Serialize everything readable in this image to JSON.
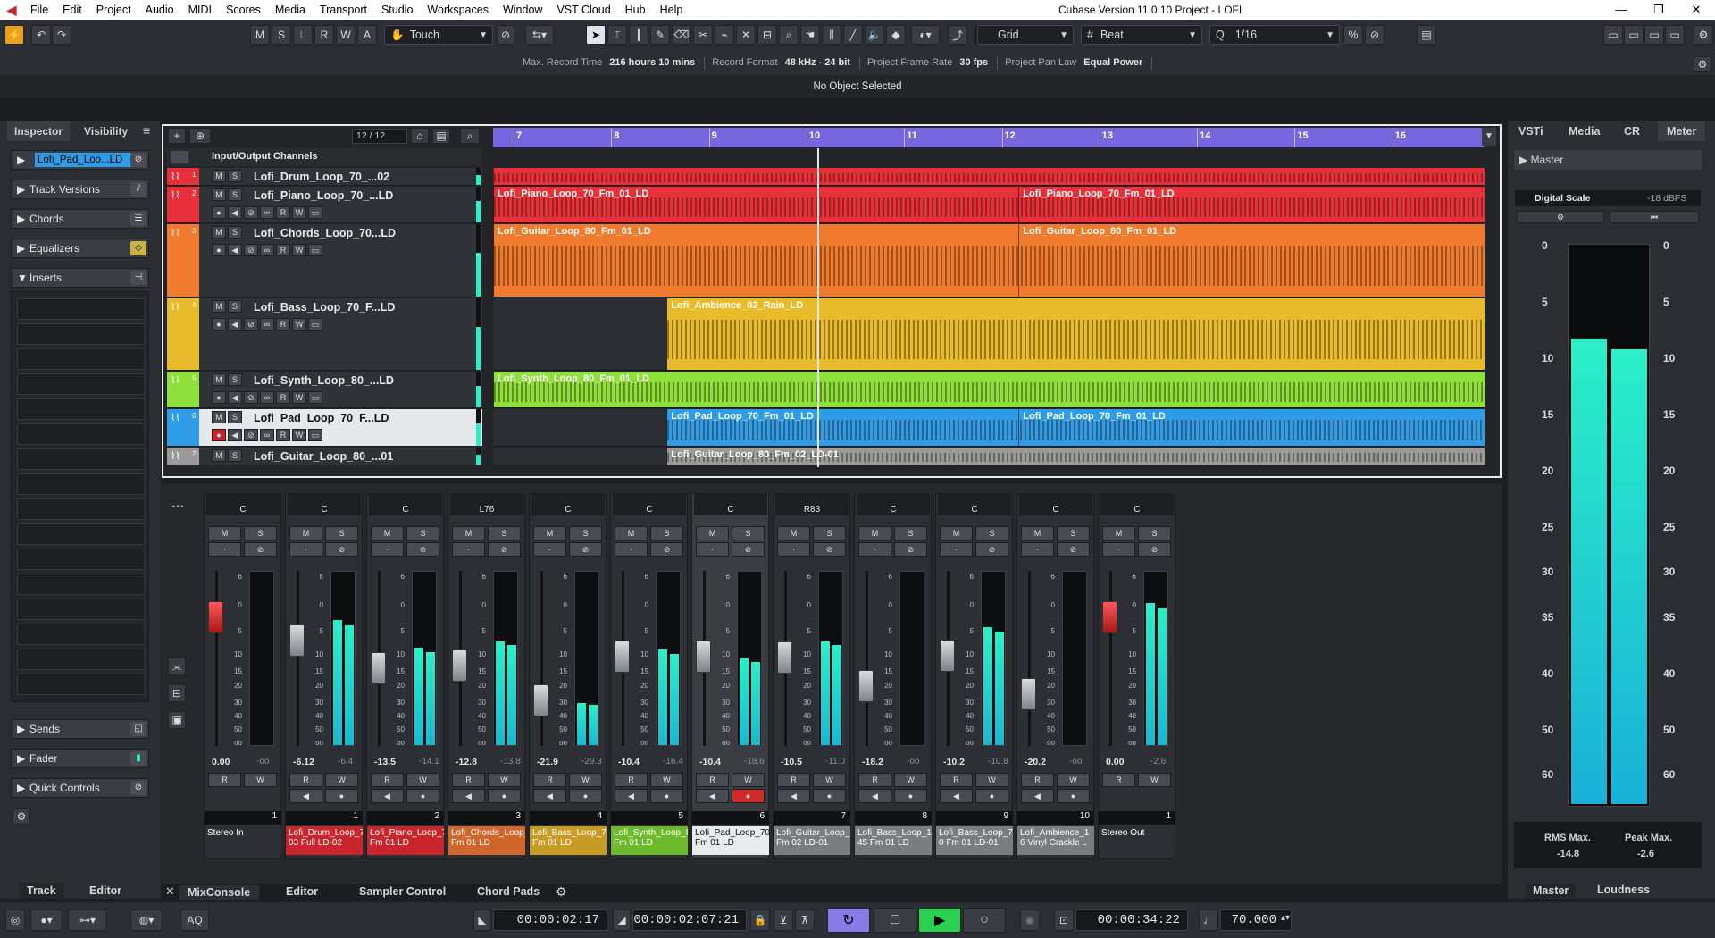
{
  "titlebar": {
    "menus": [
      "File",
      "Edit",
      "Project",
      "Audio",
      "MIDI",
      "Scores",
      "Media",
      "Transport",
      "Studio",
      "Workspaces",
      "Window",
      "VST Cloud",
      "Hub",
      "Help"
    ],
    "title": "Cubase Version 11.0.10 Project - LOFI",
    "minimize": "—",
    "maximize": "❐",
    "close": "✕"
  },
  "toolbar": {
    "state_buttons": [
      "M",
      "S",
      "L",
      "R",
      "W",
      "A"
    ],
    "automation_mode": "Touch",
    "snap_type": "Grid",
    "grid_type": "Beat",
    "quantize": "1/16",
    "info": {
      "max_record_time_label": "Max. Record Time",
      "max_record_time": "216 hours 10 mins",
      "record_format_label": "Record Format",
      "record_format": "48 kHz - 24 bit",
      "frame_rate_label": "Project Frame Rate",
      "frame_rate": "30 fps",
      "pan_law_label": "Project Pan Law",
      "pan_law": "Equal Power"
    },
    "status": "No Object Selected"
  },
  "inspector": {
    "tabs": [
      "Inspector",
      "Visibility"
    ],
    "selected_track": "Lofi_Pad_Loo...LD",
    "sections": [
      "Track Versions",
      "Chords",
      "Equalizers",
      "Inserts"
    ],
    "bottom_sections": [
      "Sends",
      "Fader",
      "Quick Controls"
    ],
    "bottom_tabs": [
      "Track",
      "Editor"
    ]
  },
  "project": {
    "position": "12 / 12",
    "io_label": "Input/Output Channels",
    "ruler": [
      "7",
      "8",
      "9",
      "10",
      "11",
      "12",
      "13",
      "14",
      "15",
      "16"
    ],
    "tracks": [
      {
        "num": "1",
        "name": "Lofi_Drum_Loop_70_...02",
        "color": "#e8303a",
        "clips": []
      },
      {
        "num": "2",
        "name": "Lofi_Piano_Loop_70_...LD",
        "color": "#e8303a",
        "clips": [
          "Lofi_Piano_Loop_70_Fm_01_LD",
          "Lofi_Piano_Loop_70_Fm_01_LD"
        ]
      },
      {
        "num": "3",
        "name": "Lofi_Chords_Loop_70...LD",
        "color": "#f07a2e",
        "clips": [
          "Lofi_Guitar_Loop_80_Fm_01_LD",
          "Lofi_Guitar_Loop_80_Fm_01_LD"
        ]
      },
      {
        "num": "4",
        "name": "Lofi_Bass_Loop_70_F...LD",
        "color": "#e8bb2a",
        "clips": [
          "Lofi_Ambience_02_Rain_LD"
        ]
      },
      {
        "num": "5",
        "name": "Lofi_Synth_Loop_80_...LD",
        "color": "#8ee03a",
        "clips": [
          "Lofi_Synth_Loop_80_Fm_01_LD"
        ]
      },
      {
        "num": "6",
        "name": "Lofi_Pad_Loop_70_F...LD",
        "color": "#2f9ce8",
        "clips": [
          "Lofi_Pad_Loop_70_Fm_01_LD",
          "Lofi_Pad_Loop_70_Fm_01_LD"
        ]
      },
      {
        "num": "7",
        "name": "Lofi_Guitar_Loop_80_...01",
        "color": "#9a9a9a",
        "clips": [
          "Lofi_Guitar_Loop_80_Fm_02_LD-01"
        ]
      }
    ]
  },
  "mixer": {
    "channels": [
      {
        "pan": "C",
        "fader": "0.00",
        "peak": "-oo",
        "num": "1",
        "name": "Stereo In",
        "color": "#2c2f33",
        "level": 0
      },
      {
        "pan": "C",
        "fader": "-6.12",
        "peak": "-6.4",
        "num": "1",
        "name": "Lofi_Drum_Loop_70 03 Full LD-02",
        "color": "#c8262c",
        "level": 0.72
      },
      {
        "pan": "C",
        "fader": "-13.5",
        "peak": "-14.1",
        "num": "2",
        "name": "Lofi_Piano_Loop_70 Fm 01 LD",
        "color": "#c8262c",
        "level": 0.56
      },
      {
        "pan": "L76",
        "fader": "-12.8",
        "peak": "-13.8",
        "num": "3",
        "name": "Lofi_Chords_Loop_70 Fm 01 LD",
        "color": "#d0662a",
        "level": 0.6
      },
      {
        "pan": "C",
        "fader": "-21.9",
        "peak": "-29.3",
        "num": "4",
        "name": "Lofi_Bass_Loop_70 Fm 01 LD",
        "color": "#c89c24",
        "level": 0.24
      },
      {
        "pan": "C",
        "fader": "-10.4",
        "peak": "-16.4",
        "num": "5",
        "name": "Lofi_Synth_Loop_80 Fm 01 LD",
        "color": "#6cba2c",
        "level": 0.55
      },
      {
        "pan": "C",
        "fader": "-10.4",
        "peak": "-18.6",
        "num": "6",
        "name": "Lofi_Pad_Loop_70 Fm 01 LD",
        "color": "#e9ebee",
        "level": 0.5
      },
      {
        "pan": "R83",
        "fader": "-10.5",
        "peak": "-11.0",
        "num": "7",
        "name": "Lofi_Guitar_Loop_80 Fm 02 LD-01",
        "color": "#7a7d80",
        "level": 0.6
      },
      {
        "pan": "C",
        "fader": "-18.2",
        "peak": "-oo",
        "num": "8",
        "name": "Lofi_Bass_Loop_1 45 Fm 01 LD",
        "color": "#7a7d80",
        "level": 0
      },
      {
        "pan": "C",
        "fader": "-10.2",
        "peak": "-10.8",
        "num": "9",
        "name": "Lofi_Bass_Loop_7 0 Fm 01 LD-01",
        "color": "#7a7d80",
        "level": 0.68
      },
      {
        "pan": "C",
        "fader": "-20.2",
        "peak": "-oo",
        "num": "10",
        "name": "Lofi_Ambience_1 6 Vinyl Crackle L",
        "color": "#7a7d80",
        "level": 0
      },
      {
        "pan": "C",
        "fader": "0.00",
        "peak": "-2.6",
        "num": "1",
        "name": "Stereo Out",
        "color": "#2c2f33",
        "level": 0.82
      }
    ],
    "scale": [
      "6",
      "0",
      "5",
      "10",
      "15",
      "20",
      "30",
      "40",
      "50",
      "oo"
    ],
    "mute": "M",
    "solo": "S",
    "read": "R",
    "write": "W"
  },
  "bottom_tabs": [
    "MixConsole",
    "Editor",
    "Sampler Control",
    "Chord Pads"
  ],
  "right_zone": {
    "tabs": [
      "VSTi",
      "Media",
      "CR",
      "Meter"
    ],
    "master": "Master",
    "digital_scale_label": "Digital Scale",
    "digital_scale": "-18 dBFS",
    "scale": [
      "0",
      "5",
      "10",
      "15",
      "20",
      "25",
      "30",
      "35",
      "40",
      "50",
      "60"
    ],
    "rms_label": "RMS Max.",
    "rms": "-14.8",
    "peak_label": "Peak Max.",
    "peak": "-2.6",
    "bottom_tabs": [
      "Master",
      "Loudness"
    ],
    "meter_level_l": 0.83,
    "meter_level_r": 0.81
  },
  "transport": {
    "left_locator": "00:00:02:17",
    "right_locator": "00:00:02:07:21",
    "position": "00:00:34:22",
    "tempo": "70.000",
    "aq": "AQ"
  }
}
